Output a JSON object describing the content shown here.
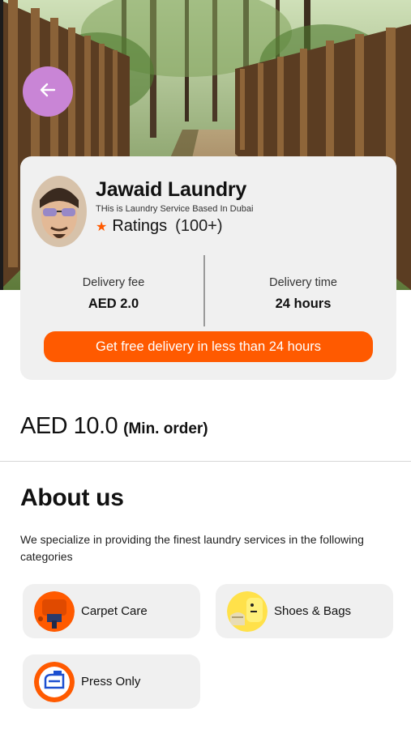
{
  "header": {
    "back_icon": "arrow-left-icon",
    "back_color": "#c985d6"
  },
  "vendor": {
    "name": "Jawaid Laundry",
    "description": "THis is Laundry Service Based In Dubai",
    "rating_icon": "star-icon",
    "rating_label": "Ratings",
    "rating_count": "(100+)"
  },
  "delivery": {
    "fee_label": "Delivery fee",
    "fee_value": "AED 2.0",
    "time_label": "Delivery time",
    "time_value": "24 hours"
  },
  "promo": {
    "label": "Get free delivery in less than 24 hours"
  },
  "min_order": {
    "amount": "AED 10.0",
    "label": "(Min. order)"
  },
  "about": {
    "title": "About us",
    "text": "We specialize in providing the finest laundry services in the following categories"
  },
  "categories": [
    {
      "label": "Carpet Care",
      "icon": "carpet-icon"
    },
    {
      "label": "Shoes & Bags",
      "icon": "shoes-bags-icon"
    },
    {
      "label": "Press Only",
      "icon": "iron-icon"
    }
  ],
  "colors": {
    "accent": "#ff5a00",
    "card_bg": "#f0f0f0"
  }
}
